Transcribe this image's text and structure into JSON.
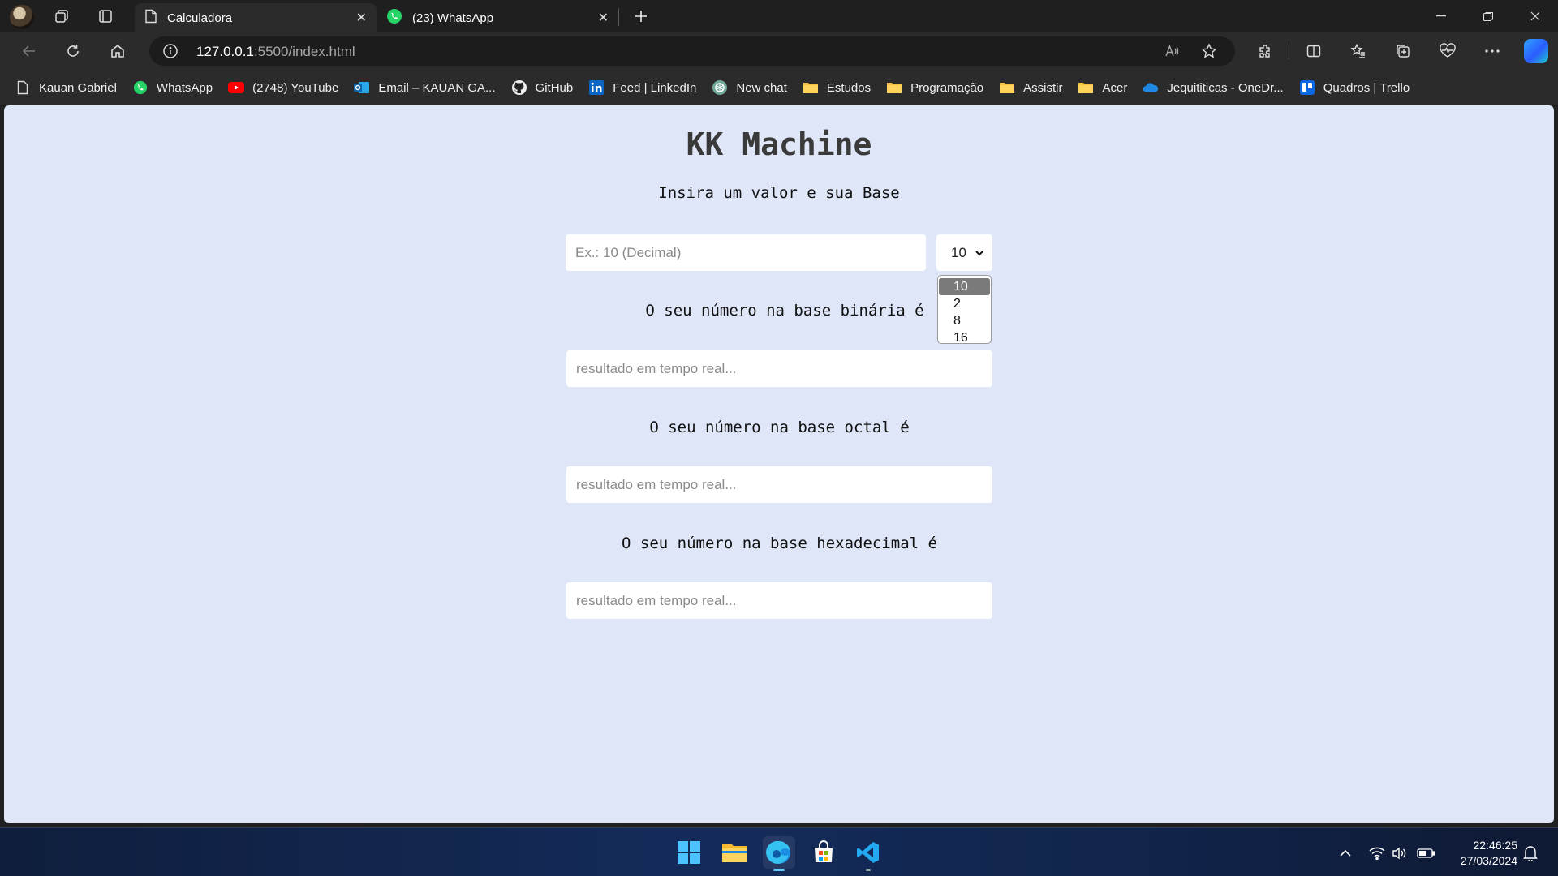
{
  "browser": {
    "tabs": [
      {
        "title": "Calculadora",
        "active": true,
        "icon": "page-icon"
      },
      {
        "title": "(23) WhatsApp",
        "active": false,
        "icon": "whatsapp-icon"
      }
    ],
    "address": {
      "host": "127.0.0.1",
      "path": ":5500/index.html"
    },
    "bookmarks": [
      {
        "label": "Kauan Gabriel",
        "icon": "page-icon"
      },
      {
        "label": "WhatsApp",
        "icon": "whatsapp-icon"
      },
      {
        "label": "(2748) YouTube",
        "icon": "youtube-icon"
      },
      {
        "label": "Email – KAUAN GA...",
        "icon": "outlook-icon"
      },
      {
        "label": "GitHub",
        "icon": "github-icon"
      },
      {
        "label": "Feed | LinkedIn",
        "icon": "linkedin-icon"
      },
      {
        "label": "New chat",
        "icon": "chatgpt-icon"
      },
      {
        "label": "Estudos",
        "icon": "folder-icon"
      },
      {
        "label": "Programação",
        "icon": "folder-icon"
      },
      {
        "label": "Assistir",
        "icon": "folder-icon"
      },
      {
        "label": "Acer",
        "icon": "folder-icon"
      },
      {
        "label": "Jequititicas - OneDr...",
        "icon": "onedrive-icon"
      },
      {
        "label": "Quadros | Trello",
        "icon": "trello-icon"
      }
    ]
  },
  "app": {
    "title": "KK Machine",
    "subtitle": "Insira um valor e sua Base",
    "input_placeholder": "Ex.: 10 (Decimal)",
    "base_selected": "10",
    "base_options": [
      "10",
      "2",
      "8",
      "16"
    ],
    "binary_label": "O seu número na base binária é",
    "octal_label": "O seu número na base octal é",
    "hex_label": "O seu número na base hexadecimal é",
    "result_placeholder": "resultado em tempo real..."
  },
  "taskbar": {
    "time": "22:46:25",
    "date": "27/03/2024"
  },
  "colors": {
    "page_bg": "#dfe6f8",
    "chrome_bg": "#2b2b2b",
    "titlebar_bg": "#1f1f1f",
    "selected_option": "#7a7a7a",
    "edge_accent": "#60cdff"
  }
}
